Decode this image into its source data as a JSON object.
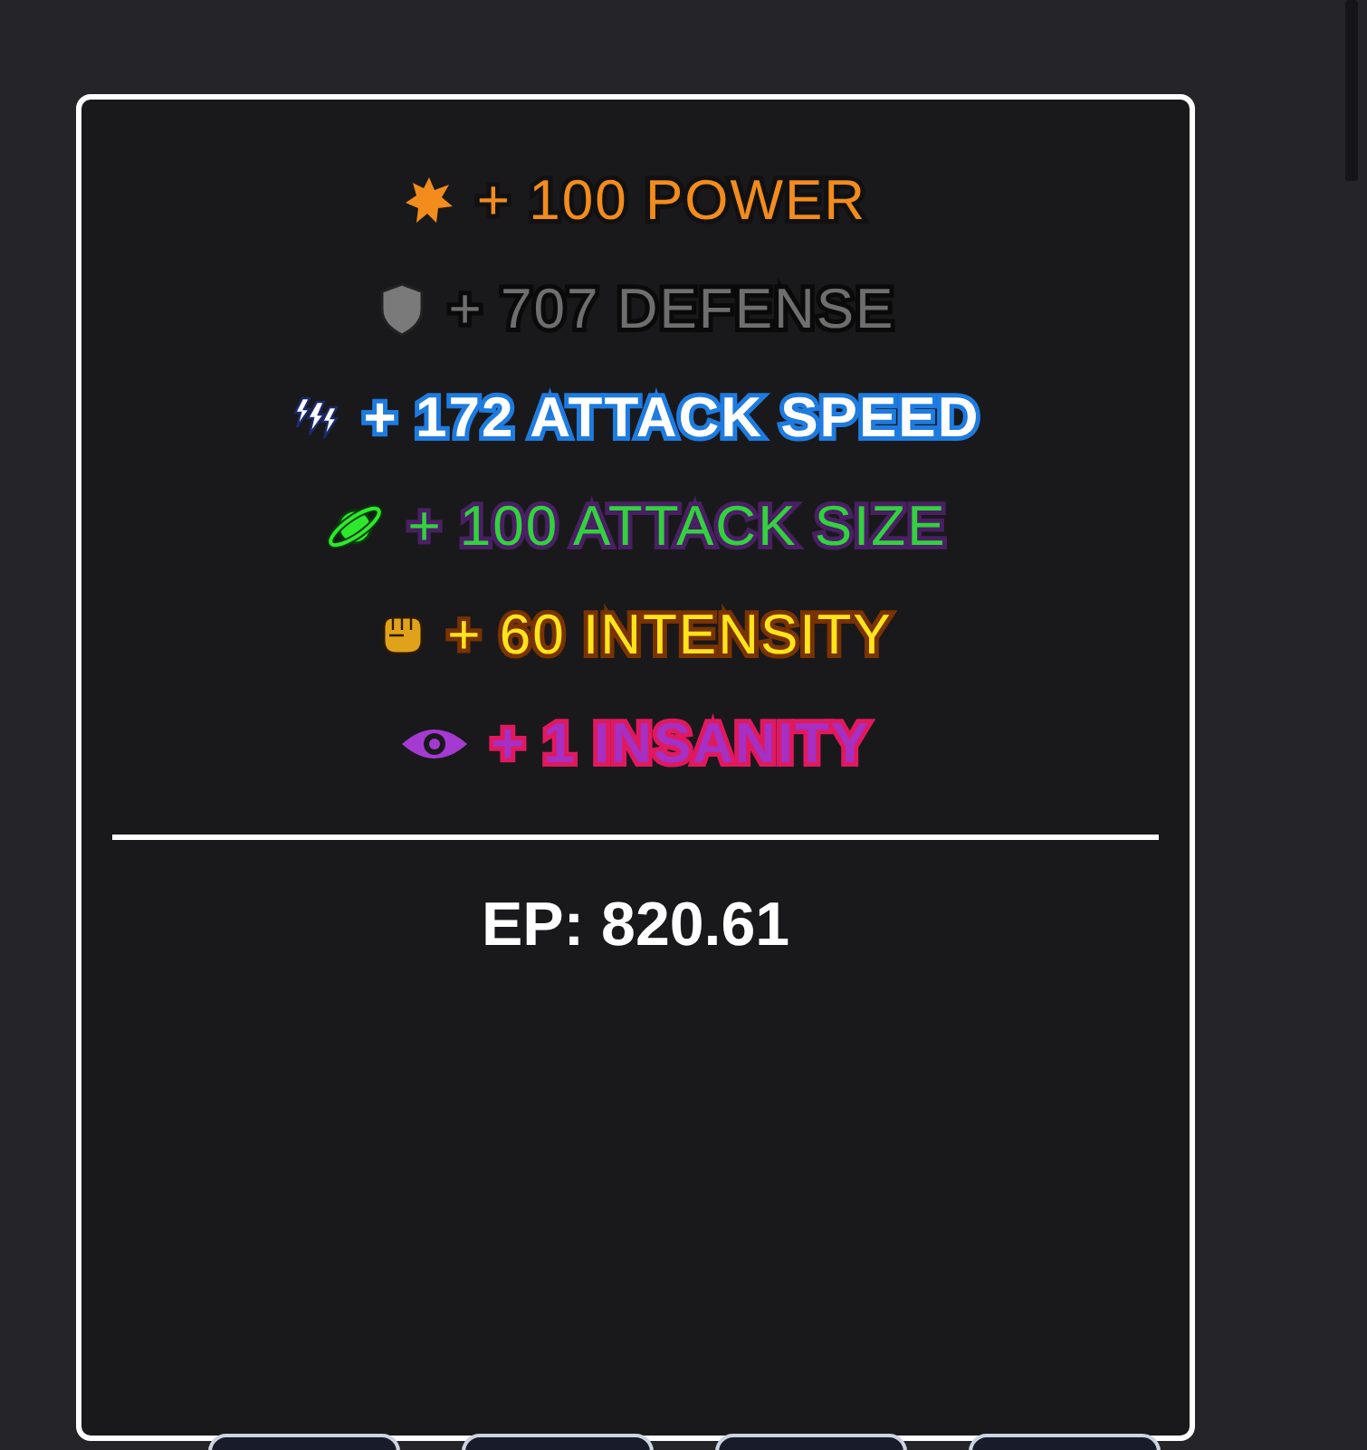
{
  "stats": [
    {
      "text": "+ 100 POWER",
      "color": "#f28c1c",
      "bold": false
    },
    {
      "text": "+ 707 DEFENSE",
      "color": "#6e6e6e",
      "bold": false
    },
    {
      "text": "+ 172 ATTACK SPEED",
      "color": "#ffffff",
      "bold": true
    },
    {
      "text": "+ 100 ATTACK SIZE",
      "color": "#33d13f",
      "bold": false
    },
    {
      "text": "+ 60 INTENSITY",
      "color": "#ffe41a",
      "bold": false
    },
    {
      "text": "+ 1 INSANITY",
      "color": "#a62fc4",
      "bold": true
    }
  ],
  "ep": "EP: 820.61"
}
